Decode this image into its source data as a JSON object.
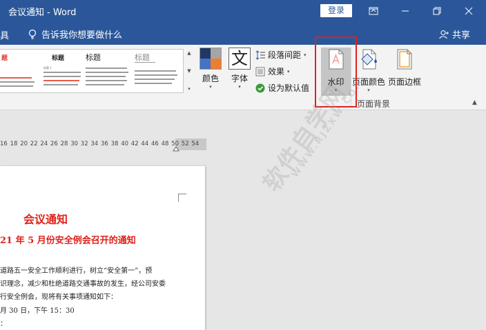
{
  "window": {
    "title": "会议通知  -  Word",
    "login_label": "登录"
  },
  "tellbar": {
    "edge_tab": "具",
    "tell_me": "告诉我你想要做什么",
    "share": "共享"
  },
  "gallery": {
    "style1_heading": "题",
    "style2_heading": "标题",
    "style3_heading": "标题",
    "style4_heading": "标题",
    "style2_sub": "标题 1"
  },
  "ribbon": {
    "colors_label": "颜色",
    "fonts_label": "字体",
    "paragraph_spacing": "段落间距",
    "effects": "效果",
    "set_default": "设为默认值",
    "watermark": "水印",
    "page_color": "页面颜色",
    "page_border": "页面边框",
    "group_page_background": "页面背景"
  },
  "ruler": [
    "16",
    "18",
    "20",
    "22",
    "24",
    "26",
    "28",
    "30",
    "32",
    "34",
    "36",
    "38",
    "40",
    "42",
    "44",
    "46",
    "48",
    "50",
    "52",
    "54"
  ],
  "document": {
    "title": "会议通知",
    "subtitle": "21 年 5 月份安全例会召开的通知",
    "lines": [
      "道路五一安全工作顺利进行，树立“安全第一”，预",
      "识理念，减少和杜绝道路交通事故的发生，经公司安委",
      "行安全例会，现将有关事项通知如下：",
      "月 30 日，下午 15：30",
      "："
    ]
  },
  "watermark_text": {
    "main": "软件自学网",
    "url": "WWW.RJZXW.COM"
  },
  "colors": {
    "brand": "#2b579a",
    "highlight": "#e02020",
    "doc_red": "#e0201a"
  }
}
